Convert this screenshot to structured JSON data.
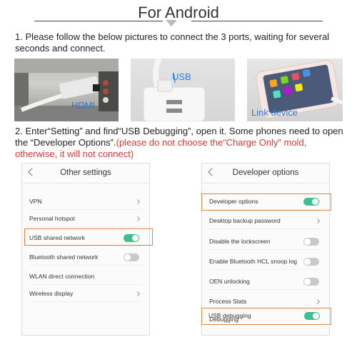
{
  "header": {
    "title": "For Android"
  },
  "step1": {
    "text": "1. Please follow the below pictures to connect the 3 ports, waiting for several seconds and connect."
  },
  "photos": [
    {
      "label": "HDMI",
      "label_color": "#2e7bd8"
    },
    {
      "label": "USB",
      "label_color": "#2e7bd8"
    },
    {
      "label": "Link device",
      "label_color": "#2e7bd8"
    }
  ],
  "step2": {
    "text": "2. Enter“Setting” and find“USB Debugging”, open it. Some phones need to open the “Developer Options”.",
    "warning": "(please do not choose the“Charge Only” mold, otherwise, it will not connect)",
    "warning_color": "#e03434"
  },
  "screens": {
    "left": {
      "title": "Other settings",
      "rows": [
        {
          "label": "VPN",
          "control": "chevron"
        },
        {
          "label": "Personal hotspot",
          "control": "chevron"
        },
        {
          "label": "USB shared network",
          "control": "toggle",
          "toggle_on": true,
          "highlighted": true
        },
        {
          "label": "Bluetooth shared network",
          "control": "toggle",
          "toggle_on": false
        },
        {
          "label": "WLAN direct connection",
          "control": "none"
        },
        {
          "label": "Wireless display",
          "control": "chevron"
        }
      ]
    },
    "right": {
      "title": "Developer options",
      "rows": [
        {
          "label": "Developer options",
          "control": "toggle",
          "toggle_on": true,
          "highlighted": true
        },
        {
          "label": "Desktop backup password",
          "control": "chevron"
        },
        {
          "label": "Disable the lockscreen",
          "control": "toggle",
          "toggle_on": false
        },
        {
          "label": "Enable Bluetooth HCL snoop log",
          "control": "toggle",
          "toggle_on": false
        },
        {
          "label": "OEN unlocking",
          "control": "toggle",
          "toggle_on": false
        },
        {
          "label": "Process Stats",
          "control": "chevron"
        },
        {
          "label": "Debugging",
          "control": "none"
        },
        {
          "label": "USB debugging",
          "control": "toggle",
          "toggle_on": true,
          "highlighted": true
        }
      ]
    }
  },
  "colors": {
    "toggle_on": "#3fbf8f",
    "highlight": "#e8823a"
  }
}
